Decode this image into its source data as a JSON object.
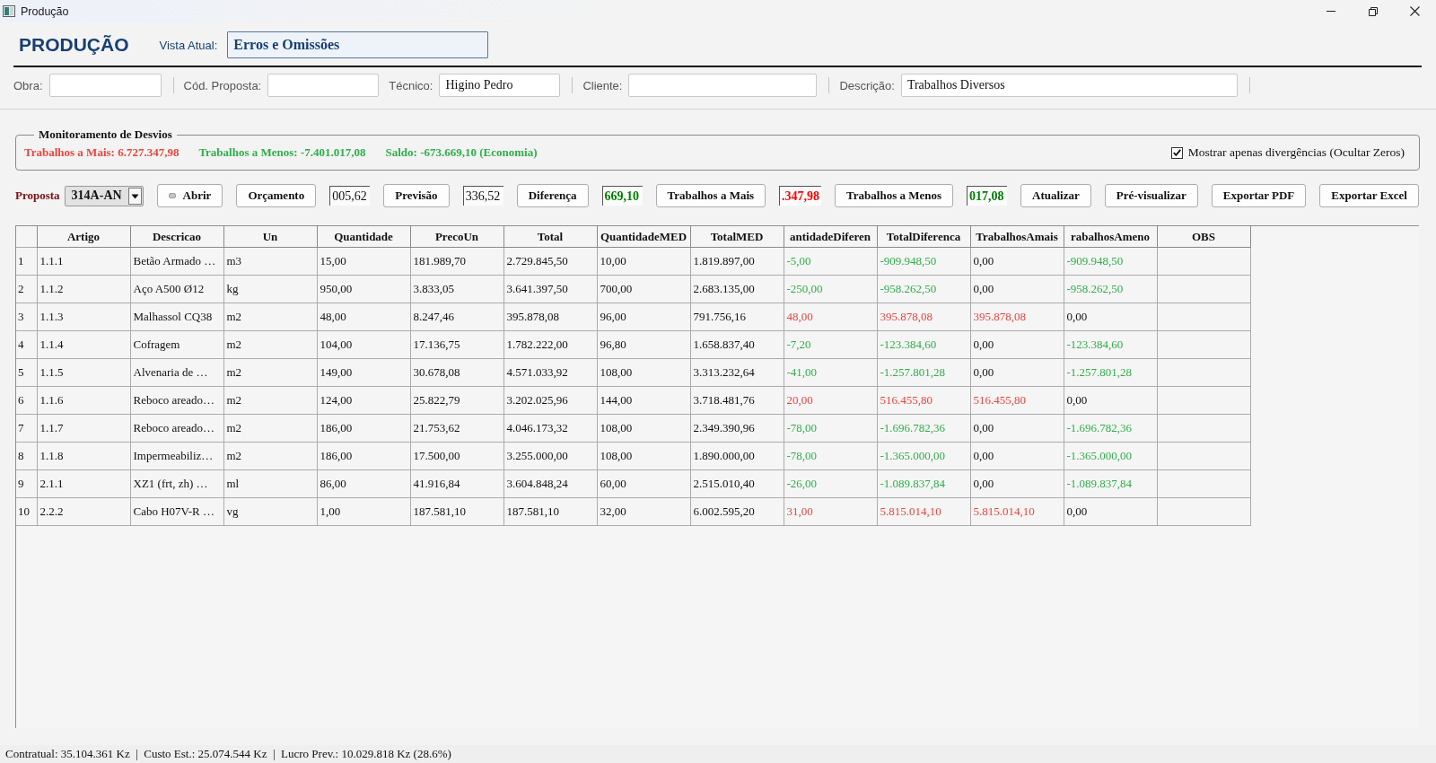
{
  "window": {
    "title": "Produção"
  },
  "header": {
    "title": "PRODUÇÃO",
    "view_label": "Vista Atual:",
    "view_value": "Erros e Omissões"
  },
  "field_groups": [
    {
      "fields": [
        {
          "label": "Obra:"
        }
      ]
    },
    {
      "fields": [
        {
          "label": "Cód. Proposta:"
        },
        {
          "label": "Técnico:",
          "value": "Higino Pedro"
        }
      ]
    },
    {
      "fields": [
        {
          "label": "Cliente:"
        }
      ]
    },
    {
      "fields": [
        {
          "label": "Descrição:",
          "value": "Trabalhos Diversos"
        }
      ]
    }
  ],
  "monitoring": {
    "title": "Monitoramento de Desvios",
    "totals": [
      {
        "text": "Trabalhos a Mais: 6.727.347,98",
        "color": "#e8453c"
      },
      {
        "text": "Trabalhos a Menos: -7.401.017,08",
        "color": "#2fae4a"
      },
      {
        "text": "Saldo: -673.669,10 (Economia)",
        "color": "#2fae4a"
      }
    ],
    "filter": {
      "label": "Mostrar apenas divergências (Ocultar Zeros)",
      "checked": true
    }
  },
  "toolbar": {
    "label": "Proposta",
    "proposal": "314A-AN",
    "items": [
      {
        "kind": "icon-button",
        "label": "Abrir"
      },
      {
        "kind": "button",
        "label": "Orçamento"
      },
      {
        "kind": "readout",
        "value": "005,62"
      },
      {
        "kind": "button",
        "label": "Previsão"
      },
      {
        "kind": "readout",
        "value": "336,52"
      },
      {
        "kind": "button",
        "label": "Diferença"
      },
      {
        "kind": "readout",
        "value": "669,10",
        "color": "#008000"
      },
      {
        "kind": "button",
        "label": "Trabalhos a Mais"
      },
      {
        "kind": "readout",
        "value": ".347,98",
        "color": "#ff0000"
      },
      {
        "kind": "button",
        "label": "Trabalhos a Menos"
      },
      {
        "kind": "readout",
        "value": "017,08",
        "color": "#008000"
      },
      {
        "kind": "button",
        "label": "Atualizar"
      },
      {
        "kind": "button",
        "label": "Pré-visualizar"
      },
      {
        "kind": "button",
        "label": "Exportar PDF"
      },
      {
        "kind": "button",
        "label": "Exportar Excel"
      }
    ]
  },
  "table": {
    "columns": [
      "Artigo",
      "Descricao",
      "Un",
      "Quantidade",
      "PrecoUn",
      "Total",
      "QuantidadeMED",
      "TotalMED",
      "antidadeDiferen",
      "TotalDiferenca",
      "TrabalhosAmais",
      "rabalhosAmeno",
      "OBS"
    ],
    "rows": [
      {
        "number": "1",
        "kind": "shortfall",
        "cells": [
          "1.1.1",
          "Betão Armado …",
          "m3",
          "15,00",
          "181.989,70",
          "2.729.845,50",
          "10,00",
          "1.819.897,00",
          "-5,00",
          "-909.948,50",
          "0,00",
          "-909.948,50"
        ]
      },
      {
        "number": "2",
        "kind": "shortfall",
        "cells": [
          "1.1.2",
          "Aço A500 Ø12",
          "kg",
          "950,00",
          "3.833,05",
          "3.641.397,50",
          "700,00",
          "2.683.135,00",
          "-250,00",
          "-958.262,50",
          "0,00",
          "-958.262,50"
        ]
      },
      {
        "number": "3",
        "kind": "excess",
        "cells": [
          "1.1.3",
          "Malhassol CQ38",
          "m2",
          "48,00",
          "8.247,46",
          "395.878,08",
          "96,00",
          "791.756,16",
          "48,00",
          "395.878,08",
          "395.878,08",
          "0,00"
        ]
      },
      {
        "number": "4",
        "kind": "shortfall",
        "cells": [
          "1.1.4",
          "Cofragem",
          "m2",
          "104,00",
          "17.136,75",
          "1.782.222,00",
          "96,80",
          "1.658.837,40",
          "-7,20",
          "-123.384,60",
          "0,00",
          "-123.384,60"
        ]
      },
      {
        "number": "5",
        "kind": "shortfall",
        "cells": [
          "1.1.5",
          "Alvenaria de …",
          "m2",
          "149,00",
          "30.678,08",
          "4.571.033,92",
          "108,00",
          "3.313.232,64",
          "-41,00",
          "-1.257.801,28",
          "0,00",
          "-1.257.801,28"
        ]
      },
      {
        "number": "6",
        "kind": "excess",
        "cells": [
          "1.1.6",
          "Reboco areado…",
          "m2",
          "124,00",
          "25.822,79",
          "3.202.025,96",
          "144,00",
          "3.718.481,76",
          "20,00",
          "516.455,80",
          "516.455,80",
          "0,00"
        ]
      },
      {
        "number": "7",
        "kind": "shortfall",
        "cells": [
          "1.1.7",
          "Reboco areado…",
          "m2",
          "186,00",
          "21.753,62",
          "4.046.173,32",
          "108,00",
          "2.349.390,96",
          "-78,00",
          "-1.696.782,36",
          "0,00",
          "-1.696.782,36"
        ]
      },
      {
        "number": "8",
        "kind": "shortfall",
        "cells": [
          "1.1.8",
          "Impermeabiliz…",
          "m2",
          "186,00",
          "17.500,00",
          "3.255.000,00",
          "108,00",
          "1.890.000,00",
          "-78,00",
          "-1.365.000,00",
          "0,00",
          "-1.365.000,00"
        ]
      },
      {
        "number": "9",
        "kind": "shortfall",
        "cells": [
          "2.1.1",
          "XZ1 (frt, zh) …",
          "ml",
          "86,00",
          "41.916,84",
          "3.604.848,24",
          "60,00",
          "2.515.010,40",
          "-26,00",
          "-1.089.837,84",
          "0,00",
          "-1.089.837,84"
        ]
      },
      {
        "number": "10",
        "kind": "excess",
        "cells": [
          "2.2.2",
          "Cabo H07V-R …",
          "vg",
          "1,00",
          "187.581,10",
          "187.581,10",
          "32,00",
          "6.002.595,20",
          "31,00",
          "5.815.014,10",
          "5.815.014,10",
          "0,00"
        ]
      }
    ]
  },
  "status_bar": {
    "text": "Contratual: 35.104.361 Kz  |  Custo Est.: 25.074.544 Kz  |  Lucro Prev.: 10.029.818 Kz (28.6%)"
  }
}
